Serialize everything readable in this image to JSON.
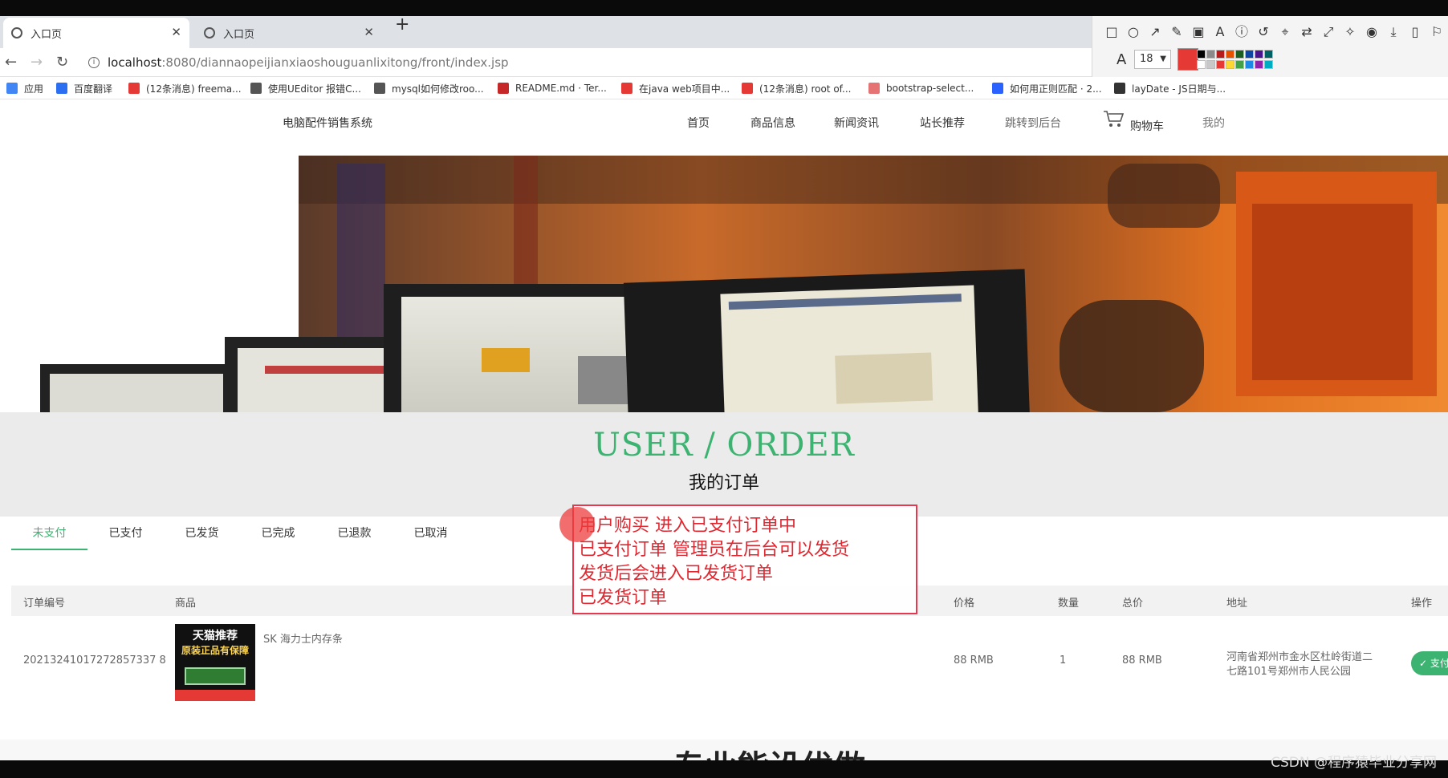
{
  "browser": {
    "tabs": [
      {
        "title": "入口页",
        "active": true
      },
      {
        "title": "入口页",
        "active": false
      }
    ],
    "new_tab": "+",
    "url_host": "localhost",
    "url_rest": ":8080/diannaopeijianxiaoshouguanlixitong/front/index.jsp",
    "bookmarks": [
      {
        "label": "应用",
        "color": "#4285f4"
      },
      {
        "label": "百度翻译",
        "color": "#2c6ef2"
      },
      {
        "label": "(12条消息) freema...",
        "color": "#e53935"
      },
      {
        "label": "使用UEditor 报错C...",
        "color": "#555555"
      },
      {
        "label": "mysql如何修改roo...",
        "color": "#555555"
      },
      {
        "label": "README.md · Ter...",
        "color": "#c62828"
      },
      {
        "label": "在java web项目中...",
        "color": "#e53935"
      },
      {
        "label": "(12条消息) root of...",
        "color": "#e53935"
      },
      {
        "label": "bootstrap-select...",
        "color": "#e57373"
      },
      {
        "label": "如何用正则匹配 · 2...",
        "color": "#2962ff"
      },
      {
        "label": "layDate - JS日期与...",
        "color": "#333333"
      }
    ]
  },
  "annotation_tool": {
    "font_size": "18",
    "current_color": "#e53935",
    "icons": [
      "rectangle-icon",
      "circle-icon",
      "arrow-icon",
      "pencil-icon",
      "mosaic-icon",
      "text-icon",
      "number-icon",
      "undo-icon",
      "pin-icon",
      "translate-icon",
      "fullscreen-icon",
      "magic-icon",
      "record-icon",
      "download-icon",
      "save-icon",
      "bookmark-icon"
    ],
    "palette": [
      "#000000",
      "#8a8a8a",
      "#b71c1c",
      "#e65100",
      "#1b5e20",
      "#0d47a1",
      "#4a148c",
      "#006064",
      "#ffffff",
      "#c8c8c8",
      "#e53935",
      "#fdd835",
      "#43a047",
      "#1e88e5",
      "#8e24aa",
      "#00acc1"
    ]
  },
  "site": {
    "title": "电脑配件销售系统",
    "nav": [
      "首页",
      "商品信息",
      "新闻资讯",
      "站长推荐",
      "跳转到后台",
      "购物车",
      "我的"
    ]
  },
  "section": {
    "heading_en": "USER / ORDER",
    "heading_cn": "我的订单"
  },
  "order_tabs": [
    {
      "label": "未支付",
      "active": true
    },
    {
      "label": "已支付",
      "active": false
    },
    {
      "label": "已发货",
      "active": false
    },
    {
      "label": "已完成",
      "active": false
    },
    {
      "label": "已退款",
      "active": false
    },
    {
      "label": "已取消",
      "active": false
    }
  ],
  "table": {
    "headers": [
      "订单编号",
      "商品",
      "价格",
      "数量",
      "总价",
      "地址",
      "操作"
    ],
    "rows": [
      {
        "order_no": "20213241017272857337 8",
        "thumb_text1": "天猫推荐",
        "thumb_text2": "原装正品有保障",
        "product": "SK 海力士内存条",
        "price": "88 RMB",
        "qty": "1",
        "total": "88 RMB",
        "address_line1": "河南省郑州市金水区杜岭街道二",
        "address_line2": "七路101号郑州市人民公园",
        "action": "支付"
      }
    ]
  },
  "annotation_note": {
    "lines": [
      "用户购买  进入已支付订单中",
      "已支付订单 管理员在后台可以发货",
      "发货后会进入已发货订单",
      "已发货订单"
    ]
  },
  "footer_peek": "专业能设优做",
  "watermark": "CSDN @程序猿毕业分享网"
}
